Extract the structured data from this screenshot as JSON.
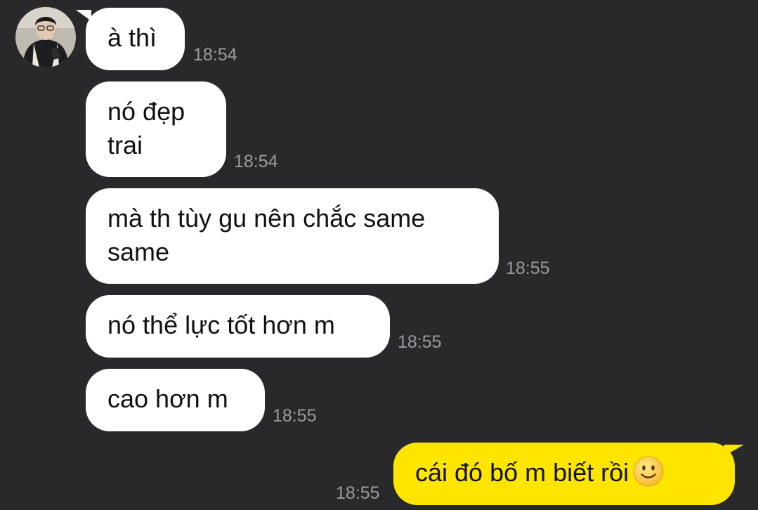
{
  "conversation": {
    "incoming": [
      {
        "text": "à thì",
        "time": "18:54"
      },
      {
        "text": "nó đẹp trai",
        "time": "18:54"
      },
      {
        "text": "mà th tùy gu nên chắc same same",
        "time": "18:55"
      },
      {
        "text": "nó thể lực tốt hơn m",
        "time": "18:55"
      },
      {
        "text": "cao hơn m",
        "time": "18:55"
      }
    ],
    "outgoing": [
      {
        "text": "cái đó bố m biết rồi",
        "emoji": "slightly-smiling-face-icon",
        "time": "18:55"
      }
    ]
  },
  "colors": {
    "background": "#29292b",
    "incoming_bubble": "#ffffff",
    "outgoing_bubble": "#fee500",
    "timestamp": "#9b9b9f",
    "text": "#111111"
  }
}
